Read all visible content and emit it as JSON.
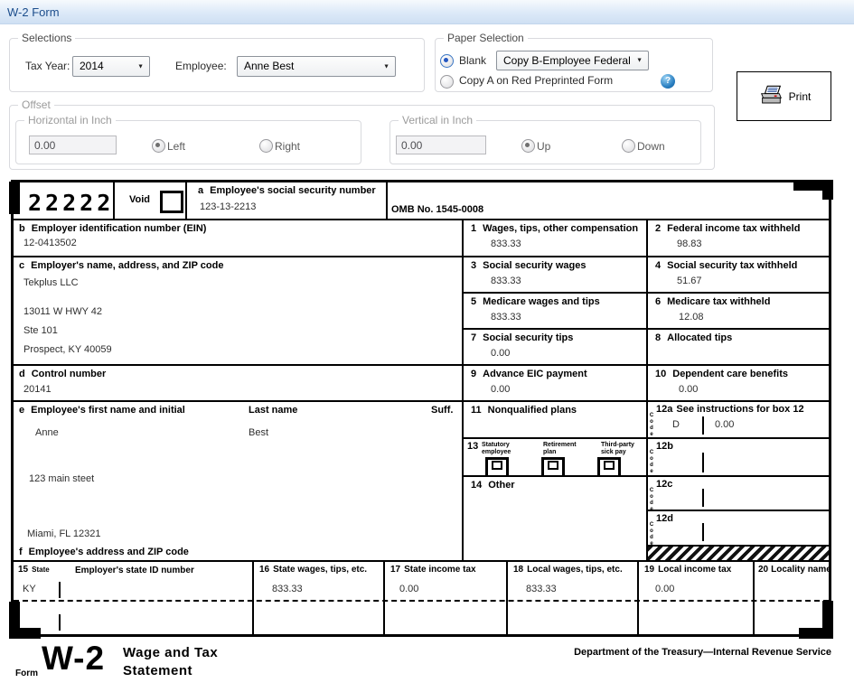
{
  "window": {
    "title": "W-2 Form"
  },
  "selections": {
    "label": "Selections",
    "tax_year": {
      "label": "Tax Year:",
      "value": "2014"
    },
    "employee": {
      "label": "Employee:",
      "value": "Anne Best"
    }
  },
  "paper": {
    "label": "Paper Selection",
    "blank": "Blank",
    "copy_value": "Copy B-Employee Federal",
    "copy_a": "Copy A on Red Preprinted Form",
    "help": "?"
  },
  "print": {
    "label": "Print"
  },
  "offset": {
    "label": "Offset",
    "horizontal": {
      "label": "Horizontal in Inch",
      "value": "0.00",
      "left": "Left",
      "right": "Right"
    },
    "vertical": {
      "label": "Vertical in Inch",
      "value": "0.00",
      "up": "Up",
      "down": "Down"
    }
  },
  "w2": {
    "code22222": "22222",
    "void": "Void",
    "omb": "OMB No. 1545-0008",
    "a": {
      "num": "a",
      "label": "Employee's social security number",
      "value": "123-13-2213"
    },
    "b": {
      "num": "b",
      "label": "Employer identification number (EIN)",
      "value": "12-0413502"
    },
    "c": {
      "num": "c",
      "label": "Employer's name, address, and ZIP code",
      "line1": "Tekplus LLC",
      "line2": "13011 W HWY 42",
      "line3": "Ste 101",
      "line4": "Prospect, KY 40059"
    },
    "d": {
      "num": "d",
      "label": "Control number",
      "value": "20141"
    },
    "e": {
      "num": "e",
      "label": "Employee's first name and initial",
      "last_label": "Last name",
      "suff_label": "Suff.",
      "first": "Anne",
      "last": "Best",
      "street": "123 main steet",
      "city": "Miami, FL 12321"
    },
    "f": {
      "num": "f",
      "label": "Employee's address and ZIP code"
    },
    "b1": {
      "num": "1",
      "label": "Wages, tips, other compensation",
      "value": "833.33"
    },
    "b2": {
      "num": "2",
      "label": "Federal income tax withheld",
      "value": "98.83"
    },
    "b3": {
      "num": "3",
      "label": "Social security wages",
      "value": "833.33"
    },
    "b4": {
      "num": "4",
      "label": "Social security tax withheld",
      "value": "51.67"
    },
    "b5": {
      "num": "5",
      "label": "Medicare wages and tips",
      "value": "833.33"
    },
    "b6": {
      "num": "6",
      "label": "Medicare tax withheld",
      "value": "12.08"
    },
    "b7": {
      "num": "7",
      "label": "Social security tips",
      "value": "0.00"
    },
    "b8": {
      "num": "8",
      "label": "Allocated tips",
      "value": ""
    },
    "b9": {
      "num": "9",
      "label": "Advance EIC payment",
      "value": "0.00"
    },
    "b10": {
      "num": "10",
      "label": "Dependent care benefits",
      "value": "0.00"
    },
    "b11": {
      "num": "11",
      "label": "Nonqualified plans",
      "value": ""
    },
    "b12a": {
      "num": "12a",
      "label": "See instructions for box 12",
      "code_word": "Code",
      "code": "D",
      "value": "0.00"
    },
    "b12b": {
      "num": "12b",
      "code_word": "Code"
    },
    "b12c": {
      "num": "12c",
      "code_word": "Code"
    },
    "b12d": {
      "num": "12d",
      "code_word": "Code"
    },
    "b13": {
      "num": "13",
      "cb1": "Statutory\nemployee",
      "cb2": "Retirement\nplan",
      "cb3": "Third-party\nsick pay"
    },
    "b14": {
      "num": "14",
      "label": "Other"
    },
    "b15": {
      "num": "15",
      "state_label": "State",
      "value": "KY",
      "id_label": "Employer's state ID number"
    },
    "b16": {
      "num": "16",
      "label": "State wages, tips, etc.",
      "value": "833.33"
    },
    "b17": {
      "num": "17",
      "label": "State income tax",
      "value": "0.00"
    },
    "b18": {
      "num": "18",
      "label": "Local wages, tips, etc.",
      "value": "833.33"
    },
    "b19": {
      "num": "19",
      "label": "Local income tax",
      "value": "0.00"
    },
    "b20": {
      "num": "20",
      "label": "Locality name",
      "value": ""
    },
    "footer": {
      "form_word": "Form",
      "w2": "W-2",
      "title_line1": "Wage and Tax",
      "title_line2": "Statement",
      "dept": "Department of the Treasury—Internal Revenue Service"
    }
  }
}
